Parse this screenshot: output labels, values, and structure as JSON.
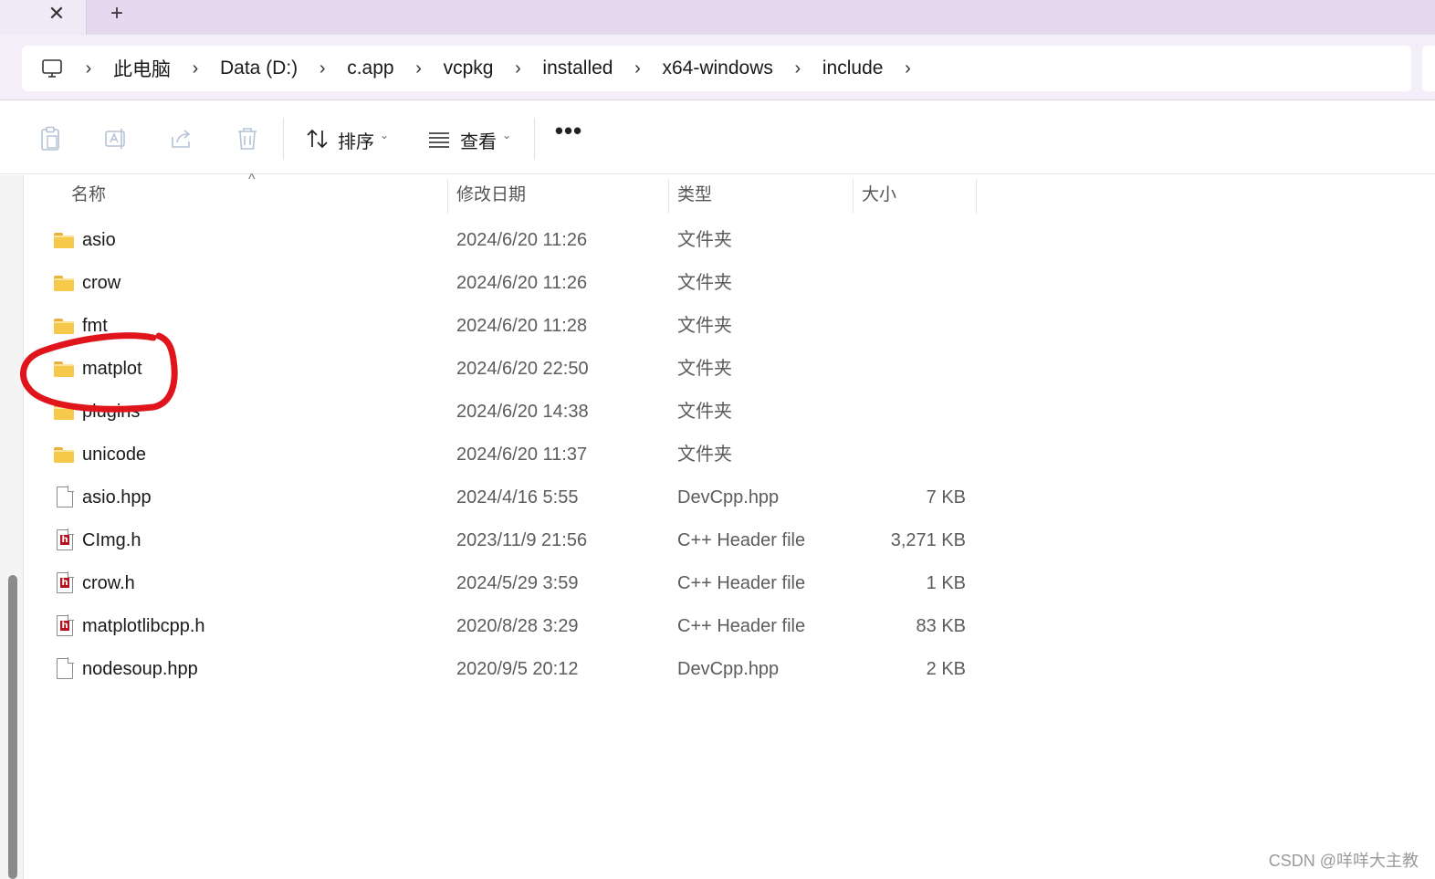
{
  "tabs": {
    "close_glyph": "✕",
    "new_tab_glyph": "+"
  },
  "breadcrumb": {
    "items": [
      "此电脑",
      "Data (D:)",
      "c.app",
      "vcpkg",
      "installed",
      "x64-windows",
      "include"
    ],
    "separator": "›"
  },
  "toolbar": {
    "sort_label": "排序",
    "view_label": "查看",
    "more_label": "•••"
  },
  "columns": {
    "name": "名称",
    "modified": "修改日期",
    "type": "类型",
    "size": "大小"
  },
  "files": [
    {
      "name": "asio",
      "modified": "2024/6/20 11:26",
      "type": "文件夹",
      "size": "",
      "icon": "folder-icon"
    },
    {
      "name": "crow",
      "modified": "2024/6/20 11:26",
      "type": "文件夹",
      "size": "",
      "icon": "folder-icon"
    },
    {
      "name": "fmt",
      "modified": "2024/6/20 11:28",
      "type": "文件夹",
      "size": "",
      "icon": "folder-icon"
    },
    {
      "name": "matplot",
      "modified": "2024/6/20 22:50",
      "type": "文件夹",
      "size": "",
      "icon": "folder-icon"
    },
    {
      "name": "plugins",
      "modified": "2024/6/20 14:38",
      "type": "文件夹",
      "size": "",
      "icon": "folder-icon"
    },
    {
      "name": "unicode",
      "modified": "2024/6/20 11:37",
      "type": "文件夹",
      "size": "",
      "icon": "folder-icon"
    },
    {
      "name": "asio.hpp",
      "modified": "2024/4/16 5:55",
      "type": "DevCpp.hpp",
      "size": "7 KB",
      "icon": "document-icon"
    },
    {
      "name": "CImg.h",
      "modified": "2023/11/9 21:56",
      "type": "C++ Header file",
      "size": "3,271 KB",
      "icon": "header-file-icon"
    },
    {
      "name": "crow.h",
      "modified": "2024/5/29 3:59",
      "type": "C++ Header file",
      "size": "1 KB",
      "icon": "header-file-icon"
    },
    {
      "name": "matplotlibcpp.h",
      "modified": "2020/8/28 3:29",
      "type": "C++ Header file",
      "size": "83 KB",
      "icon": "header-file-icon"
    },
    {
      "name": "nodesoup.hpp",
      "modified": "2020/9/5 20:12",
      "type": "DevCpp.hpp",
      "size": "2 KB",
      "icon": "document-icon"
    }
  ],
  "colors": {
    "tabstrip": "#e6d9ef",
    "annotation": "#e0141b",
    "folder": "#f6c94b"
  },
  "watermark": "CSDN @咩咩大主教"
}
